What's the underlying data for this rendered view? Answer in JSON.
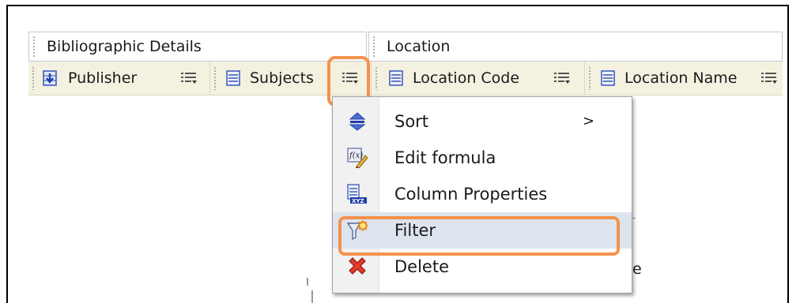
{
  "groups": {
    "bibliographic": "Bibliographic Details",
    "location": "Location"
  },
  "columns": [
    {
      "label": "Publisher",
      "icon": "foreign-key-column-icon"
    },
    {
      "label": "Subjects",
      "icon": "text-column-icon"
    },
    {
      "label": "Location Code",
      "icon": "text-column-icon"
    },
    {
      "label": "Location Name",
      "icon": "text-column-icon"
    }
  ],
  "menu": {
    "items": [
      {
        "label": "Sort",
        "icon": "sort-icon",
        "submenu": ">"
      },
      {
        "label": "Edit formula",
        "icon": "edit-formula-icon"
      },
      {
        "label": "Column Properties",
        "icon": "column-properties-icon"
      },
      {
        "label": "Filter",
        "icon": "filter-icon"
      },
      {
        "label": "Delete",
        "icon": "delete-icon"
      }
    ]
  },
  "background": {
    "partial_text": "e"
  },
  "colors": {
    "highlight": "#f3924a",
    "header_bg": "#f4f1e1",
    "active_item_bg": "#dde4ee"
  }
}
